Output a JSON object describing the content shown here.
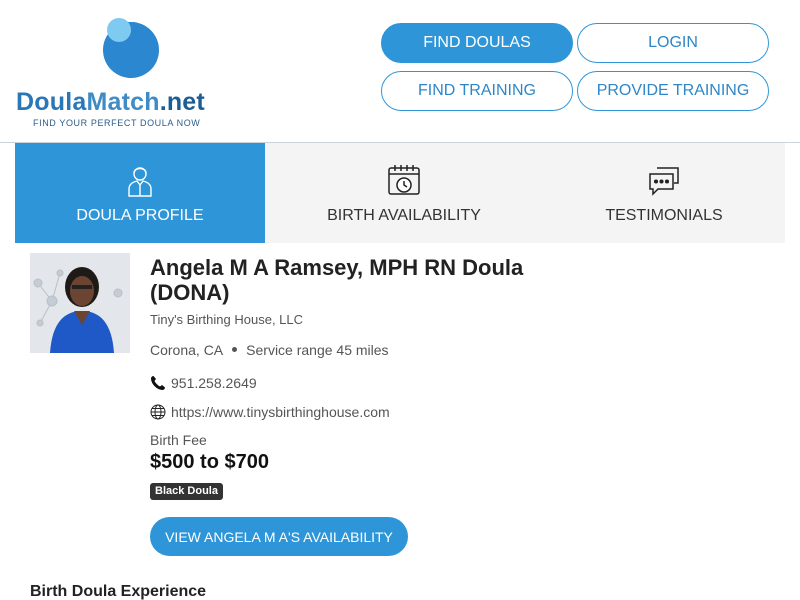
{
  "logo": {
    "brand_doula": "Doula",
    "brand_match": "Match",
    "brand_net": ".net",
    "tagline": "FIND YOUR PERFECT DOULA NOW"
  },
  "nav": {
    "find_doulas": "FIND DOULAS",
    "login": "LOGIN",
    "find_training": "FIND TRAINING",
    "provide_training": "PROVIDE TRAINING"
  },
  "tabs": [
    {
      "label": "DOULA PROFILE",
      "icon": "person-icon",
      "active": true
    },
    {
      "label": "BIRTH AVAILABILITY",
      "icon": "calendar-clock-icon",
      "active": false
    },
    {
      "label": "TESTIMONIALS",
      "icon": "chat-bubbles-icon",
      "active": false
    }
  ],
  "profile": {
    "name": "Angela M A Ramsey, MPH RN Doula (DONA)",
    "business": "Tiny's Birthing House, LLC",
    "city": "Corona, CA",
    "service_range": "Service range 45 miles",
    "phone": "951.258.2649",
    "website": "https://www.tinysbirthinghouse.com",
    "fee_label": "Birth Fee",
    "fee": "$500 to $700",
    "badge": "Black Doula",
    "availability_button": "VIEW ANGELA M A'S AVAILABILITY"
  },
  "section": {
    "experience_title": "Birth Doula Experience"
  },
  "colors": {
    "primary": "#2e96d8",
    "brand_dark": "#1c5d94",
    "badge_bg": "#333333"
  }
}
